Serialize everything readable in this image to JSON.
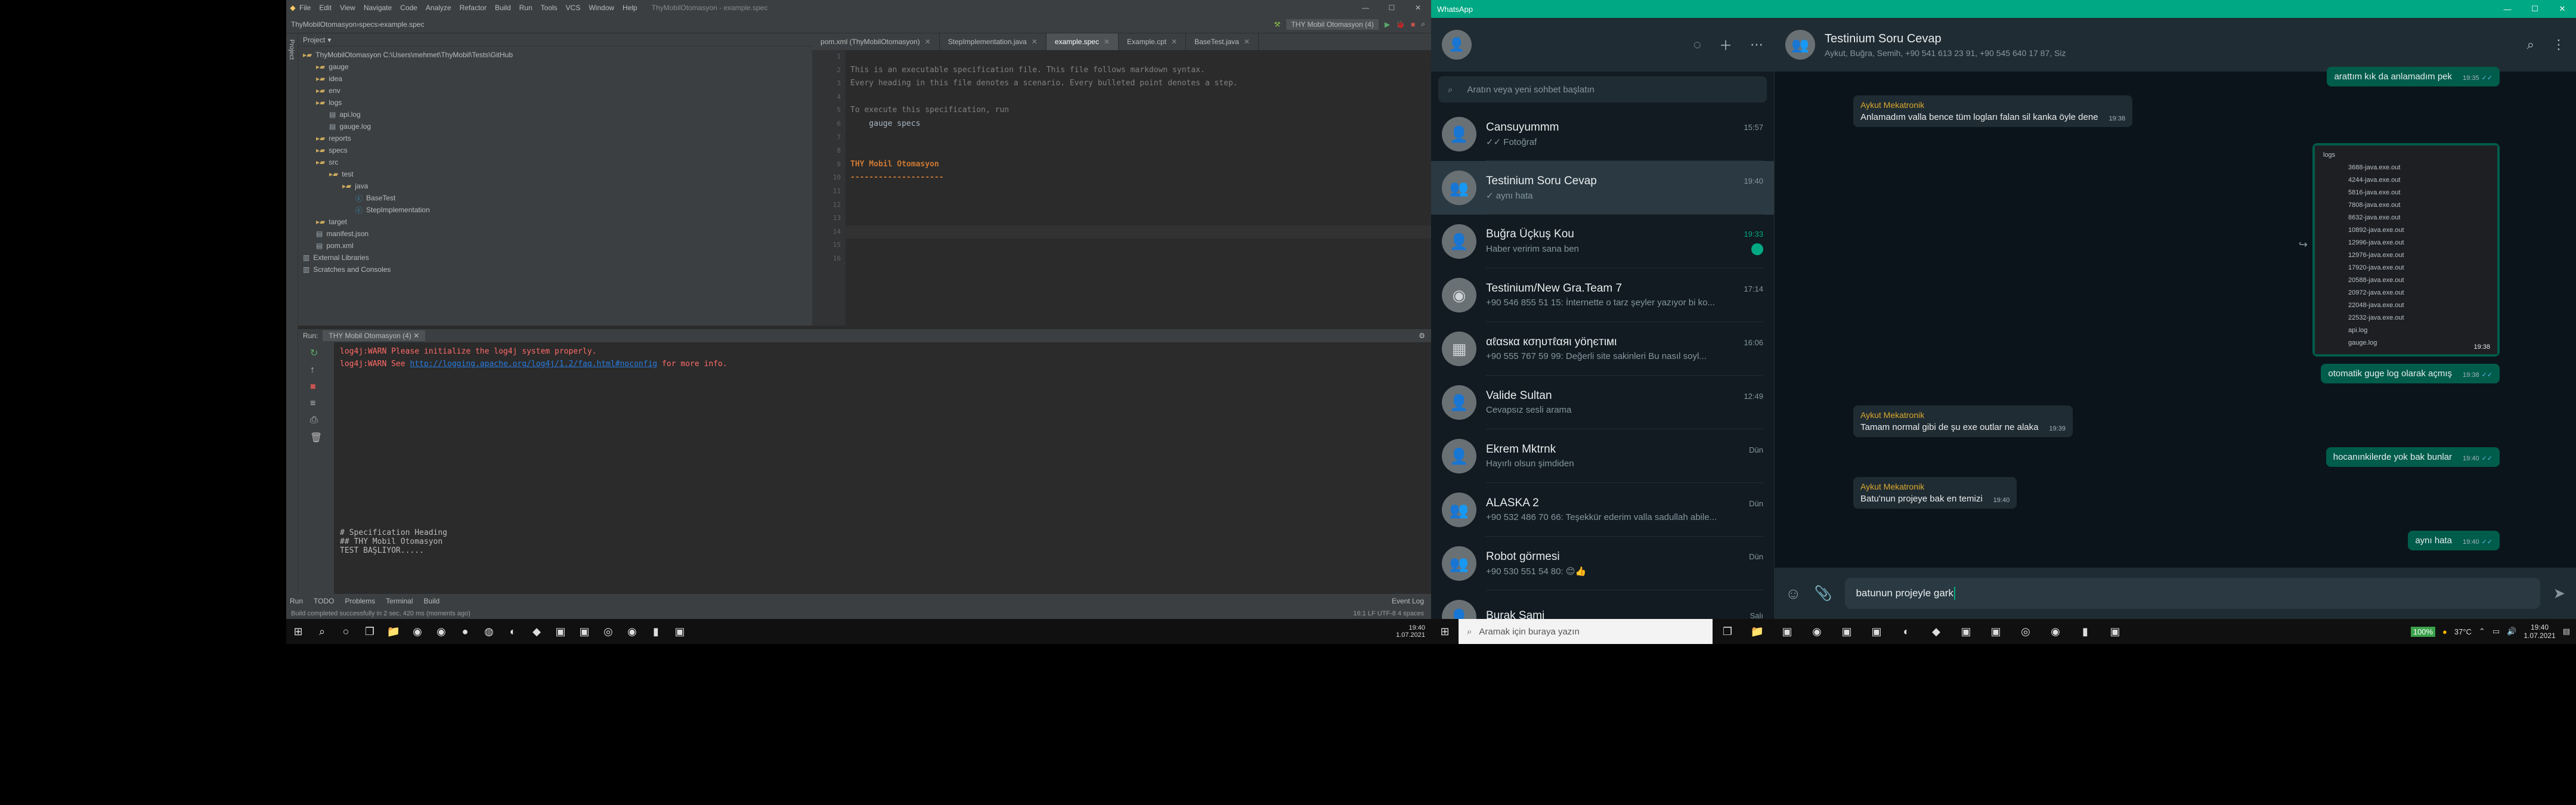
{
  "ide": {
    "title": "ThyMobilOtomasyon - example.spec",
    "menu": [
      "File",
      "Edit",
      "View",
      "Navigate",
      "Code",
      "Analyze",
      "Refactor",
      "Build",
      "Run",
      "Tools",
      "VCS",
      "Window",
      "Help"
    ],
    "breadcrumb": [
      "ThyMobilOtomasyon",
      "specs",
      "example.spec"
    ],
    "run_config": "THY Mobil Otomasyon (4)",
    "project_label": "Project",
    "tree": [
      {
        "label": "ThyMobilOtomasyon C:\\Users\\mehmet\\ThyMobil\\Tests\\GitHub",
        "icon": "folder",
        "depth": 0
      },
      {
        "label": "gauge",
        "icon": "folder",
        "depth": 1
      },
      {
        "label": "idea",
        "icon": "folder",
        "depth": 1
      },
      {
        "label": "env",
        "icon": "folder",
        "depth": 1
      },
      {
        "label": "logs",
        "icon": "folder",
        "depth": 1
      },
      {
        "label": "api.log",
        "icon": "file",
        "depth": 2
      },
      {
        "label": "gauge.log",
        "icon": "file",
        "depth": 2
      },
      {
        "label": "reports",
        "icon": "folder",
        "depth": 1
      },
      {
        "label": "specs",
        "icon": "folder",
        "depth": 1
      },
      {
        "label": "src",
        "icon": "folder",
        "depth": 1
      },
      {
        "label": "test",
        "icon": "folder",
        "depth": 2
      },
      {
        "label": "java",
        "icon": "folder",
        "depth": 3
      },
      {
        "label": "BaseTest",
        "icon": "class",
        "depth": 4
      },
      {
        "label": "StepImplementation",
        "icon": "class",
        "depth": 4
      },
      {
        "label": "target",
        "icon": "folder",
        "depth": 1
      },
      {
        "label": "manifest.json",
        "icon": "file",
        "depth": 1
      },
      {
        "label": "pom.xml",
        "icon": "file",
        "depth": 1
      },
      {
        "label": "External Libraries",
        "icon": "lib",
        "depth": 0
      },
      {
        "label": "Scratches and Consoles",
        "icon": "lib",
        "depth": 0
      }
    ],
    "tabs": [
      {
        "label": "pom.xml (ThyMobilOtomasyon)",
        "active": false
      },
      {
        "label": "StepImplementation.java",
        "active": false
      },
      {
        "label": "example.spec",
        "active": true
      },
      {
        "label": "Example.cpt",
        "active": false
      },
      {
        "label": "BaseTest.java",
        "active": false
      }
    ],
    "editor_lines": [
      {
        "n": "1",
        "text": ""
      },
      {
        "n": "2",
        "text": "This is an executable specification file. This file follows markdown syntax."
      },
      {
        "n": "3",
        "text": "Every heading in this file denotes a scenario. Every bulleted point denotes a step."
      },
      {
        "n": "4",
        "text": ""
      },
      {
        "n": "5",
        "text": "To execute this specification, run"
      },
      {
        "n": "6",
        "text": "    gauge specs"
      },
      {
        "n": "7",
        "text": ""
      },
      {
        "n": "8",
        "text": ""
      },
      {
        "n": "9",
        "text": "THY Mobil Otomasyon"
      },
      {
        "n": "10",
        "text": "--------------------"
      },
      {
        "n": "11",
        "text": ""
      },
      {
        "n": "12",
        "text": ""
      },
      {
        "n": "13",
        "text": ""
      },
      {
        "n": "14",
        "text": ""
      },
      {
        "n": "15",
        "text": ""
      },
      {
        "n": "16",
        "text": ""
      }
    ],
    "run_label": "Run:",
    "run_tab": "THY Mobil Otomasyon (4)",
    "console_warn1": "log4j:WARN Please initialize the log4j system properly.",
    "console_warn2_pre": "log4j:WARN See ",
    "console_link": "http://logging.apache.org/log4j/1.2/faq.html#noconfig",
    "console_warn2_post": " for more info.",
    "console_out": [
      "# Specification Heading",
      "  ## THY Mobil Otomasyon",
      "TEST BAŞLIYOR....."
    ],
    "bottom_tabs": [
      "Run",
      "TODO",
      "Problems",
      "Terminal",
      "Build"
    ],
    "event_log": "Event Log",
    "status_msg": "Build completed successfully in 2 sec, 420 ms (moments ago)",
    "status_right": "16:1   LF   UTF-8   4 spaces"
  },
  "taskbar_left": {
    "search_placeholder": "",
    "icons": [
      "windows-icon",
      "search-icon",
      "cortana-icon",
      "task-view-icon",
      "explorer-icon",
      "chrome-icon",
      "chrome-icon",
      "obs-icon",
      "tor-icon",
      "edge-icon",
      "intellij-icon",
      "app-icon",
      "app-icon",
      "steam-icon",
      "chrome-icon",
      "terminal-icon",
      "app-icon"
    ],
    "time": "19:40",
    "date": "1.07.2021"
  },
  "wa": {
    "window_title": "WhatsApp",
    "search_placeholder": "Aratın veya yeni sohbet başlatın",
    "chats": [
      {
        "name": "Cansuyummm",
        "time": "15:57",
        "preview": "✓✓ Fotoğraf",
        "avatar": "person"
      },
      {
        "name": "Testinium Soru Cevap",
        "time": "19:40",
        "preview": "✓ aynı hata",
        "avatar": "group",
        "selected": true
      },
      {
        "name": "Buğra Üçkuş Kou",
        "time": "19:33",
        "preview": "Haber veririm sana ben",
        "avatar": "person",
        "unread": true
      },
      {
        "name": "Testinium/New Gra.Team 7",
        "time": "17:14",
        "preview": "+90 546 855 51 15: İnternette o tarz şeyler yazıyor bi ko...",
        "avatar": "logo"
      },
      {
        "name": "αℓαѕкα кσηυтℓαяι уöηєтιмι",
        "time": "16:06",
        "preview": "+90 555 767 59 99: Değerli site sakinleri Bu nasıl soyl...",
        "avatar": "building"
      },
      {
        "name": "Valide Sultan",
        "time": "12:49",
        "preview": "Cevapsız sesli arama",
        "avatar": "person"
      },
      {
        "name": "Ekrem Mktrnk",
        "time": "Dün",
        "preview": "Hayırlı olsun şimdiden",
        "avatar": "person"
      },
      {
        "name": "ALASKA 2",
        "time": "Dün",
        "preview": "+90 532 486 70 66: Teşekkür ederim valla sadullah abile...",
        "avatar": "group"
      },
      {
        "name": "Robot görmesi",
        "time": "Dün",
        "preview": "+90 530 551 54 80: 😊👍",
        "avatar": "group"
      },
      {
        "name": "Burak Sami",
        "time": "Salı",
        "preview": "",
        "avatar": "person"
      }
    ],
    "header": {
      "name": "Testinium Soru Cevap",
      "members": "Aykut, Buğra, Semih, +90 541 613 23 91, +90 545 640 17 87, Siz"
    },
    "messages": [
      {
        "dir": "out",
        "text": "arattım kık da anlamadım pek",
        "time": "19:35"
      },
      {
        "dir": "in",
        "sender": "Aykut Mekatronik",
        "text": "Anlamadım valla bence tüm logları falan sil kanka öyle dene",
        "time": "19:38"
      },
      {
        "dir": "out",
        "kind": "image",
        "time": "19:38",
        "files": [
          "logs",
          "3688-java.exe.out",
          "4244-java.exe.out",
          "5816-java.exe.out",
          "7808-java.exe.out",
          "8632-java.exe.out",
          "10892-java.exe.out",
          "12996-java.exe.out",
          "12976-java.exe.out",
          "17920-java.exe.out",
          "20588-java.exe.out",
          "20972-java.exe.out",
          "22048-java.exe.out",
          "22532-java.exe.out",
          "api.log",
          "gauge.log"
        ]
      },
      {
        "dir": "out",
        "text": "otomatik guge log olarak açmış",
        "time": "19:38"
      },
      {
        "dir": "in",
        "sender": "Aykut Mekatronik",
        "text": "Tamam normal gibi de şu exe outlar ne alaka",
        "time": "19:39"
      },
      {
        "dir": "out",
        "text": "hocanınkilerde yok bak bunlar",
        "time": "19:40"
      },
      {
        "dir": "in",
        "sender": "Aykut Mekatronik",
        "text": "Batu'nun projeye bak en temizi",
        "time": "19:40"
      },
      {
        "dir": "out",
        "text": "aynı hata",
        "time": "19:40"
      }
    ],
    "compose_text": "batunun projeyle gark"
  },
  "taskbar_right": {
    "search_placeholder": "Aramak için buraya yazın",
    "battery": "100%",
    "weather": "37°C",
    "time": "19:40",
    "date": "1.07.2021"
  },
  "colors": {
    "wa_green": "#00a884",
    "wa_out": "#005c4b",
    "ide_bg": "#2b2b2b",
    "sender": "#d9a82e"
  }
}
